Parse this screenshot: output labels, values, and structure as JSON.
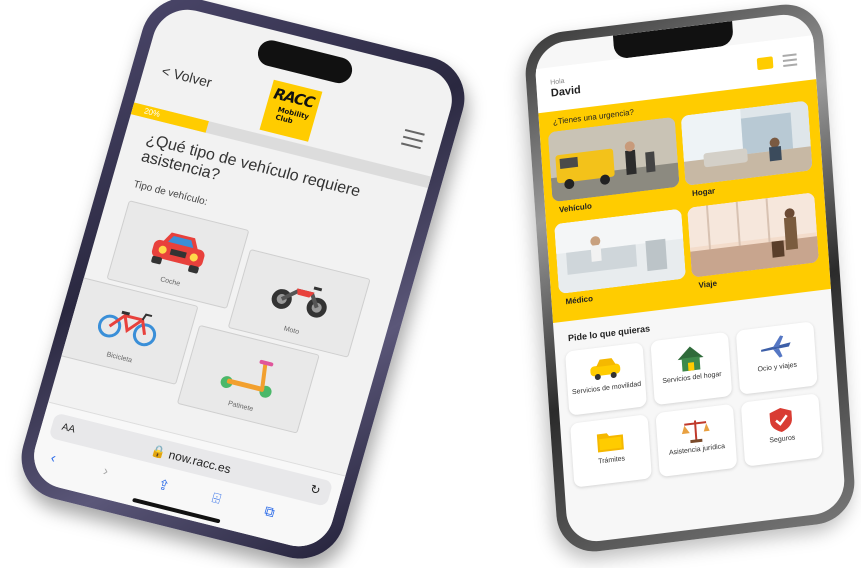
{
  "left_phone": {
    "back_label": "< Volver",
    "logo": {
      "brand": "RACC",
      "sub": "Mobility Club"
    },
    "progress": {
      "text": "20%",
      "value": 0.25
    },
    "question": "¿Qué tipo de vehículo requiere asistencia?",
    "field_label": "Tipo de vehículo:",
    "vehicles": [
      {
        "label": "Coche",
        "icon": "car-icon"
      },
      {
        "label": "Moto",
        "icon": "motorcycle-icon"
      },
      {
        "label": "Bicicleta",
        "icon": "bicycle-icon"
      },
      {
        "label": "Patinete",
        "icon": "scooter-icon"
      }
    ],
    "safari": {
      "aa": "AA",
      "url": "🔒 now.racc.es",
      "reload": "↻",
      "toolbar": [
        "‹",
        "›",
        "⇪",
        "⌹",
        "⧉"
      ]
    }
  },
  "right_phone": {
    "greeting": "Hola",
    "user_name": "David",
    "urgent_title": "¿Tienes una urgencia?",
    "tiles": [
      {
        "label": "Vehículo"
      },
      {
        "label": "Hogar"
      },
      {
        "label": "Médico"
      },
      {
        "label": "Viaje"
      }
    ],
    "quick_title": "Pide lo que quieras",
    "quick_items": [
      {
        "label": "Servicios de movilidad",
        "icon": "car-service-icon"
      },
      {
        "label": "Servicios del hogar",
        "icon": "house-icon"
      },
      {
        "label": "Ocio y viajes",
        "icon": "airplane-icon"
      },
      {
        "label": "Trámites",
        "icon": "folder-icon"
      },
      {
        "label": "Asistencia jurídica",
        "icon": "legal-scales-icon"
      },
      {
        "label": "Seguros",
        "icon": "shield-icon"
      }
    ]
  },
  "colors": {
    "brand_yellow": "#ffcc00",
    "safari_blue": "#2a6ae8"
  }
}
